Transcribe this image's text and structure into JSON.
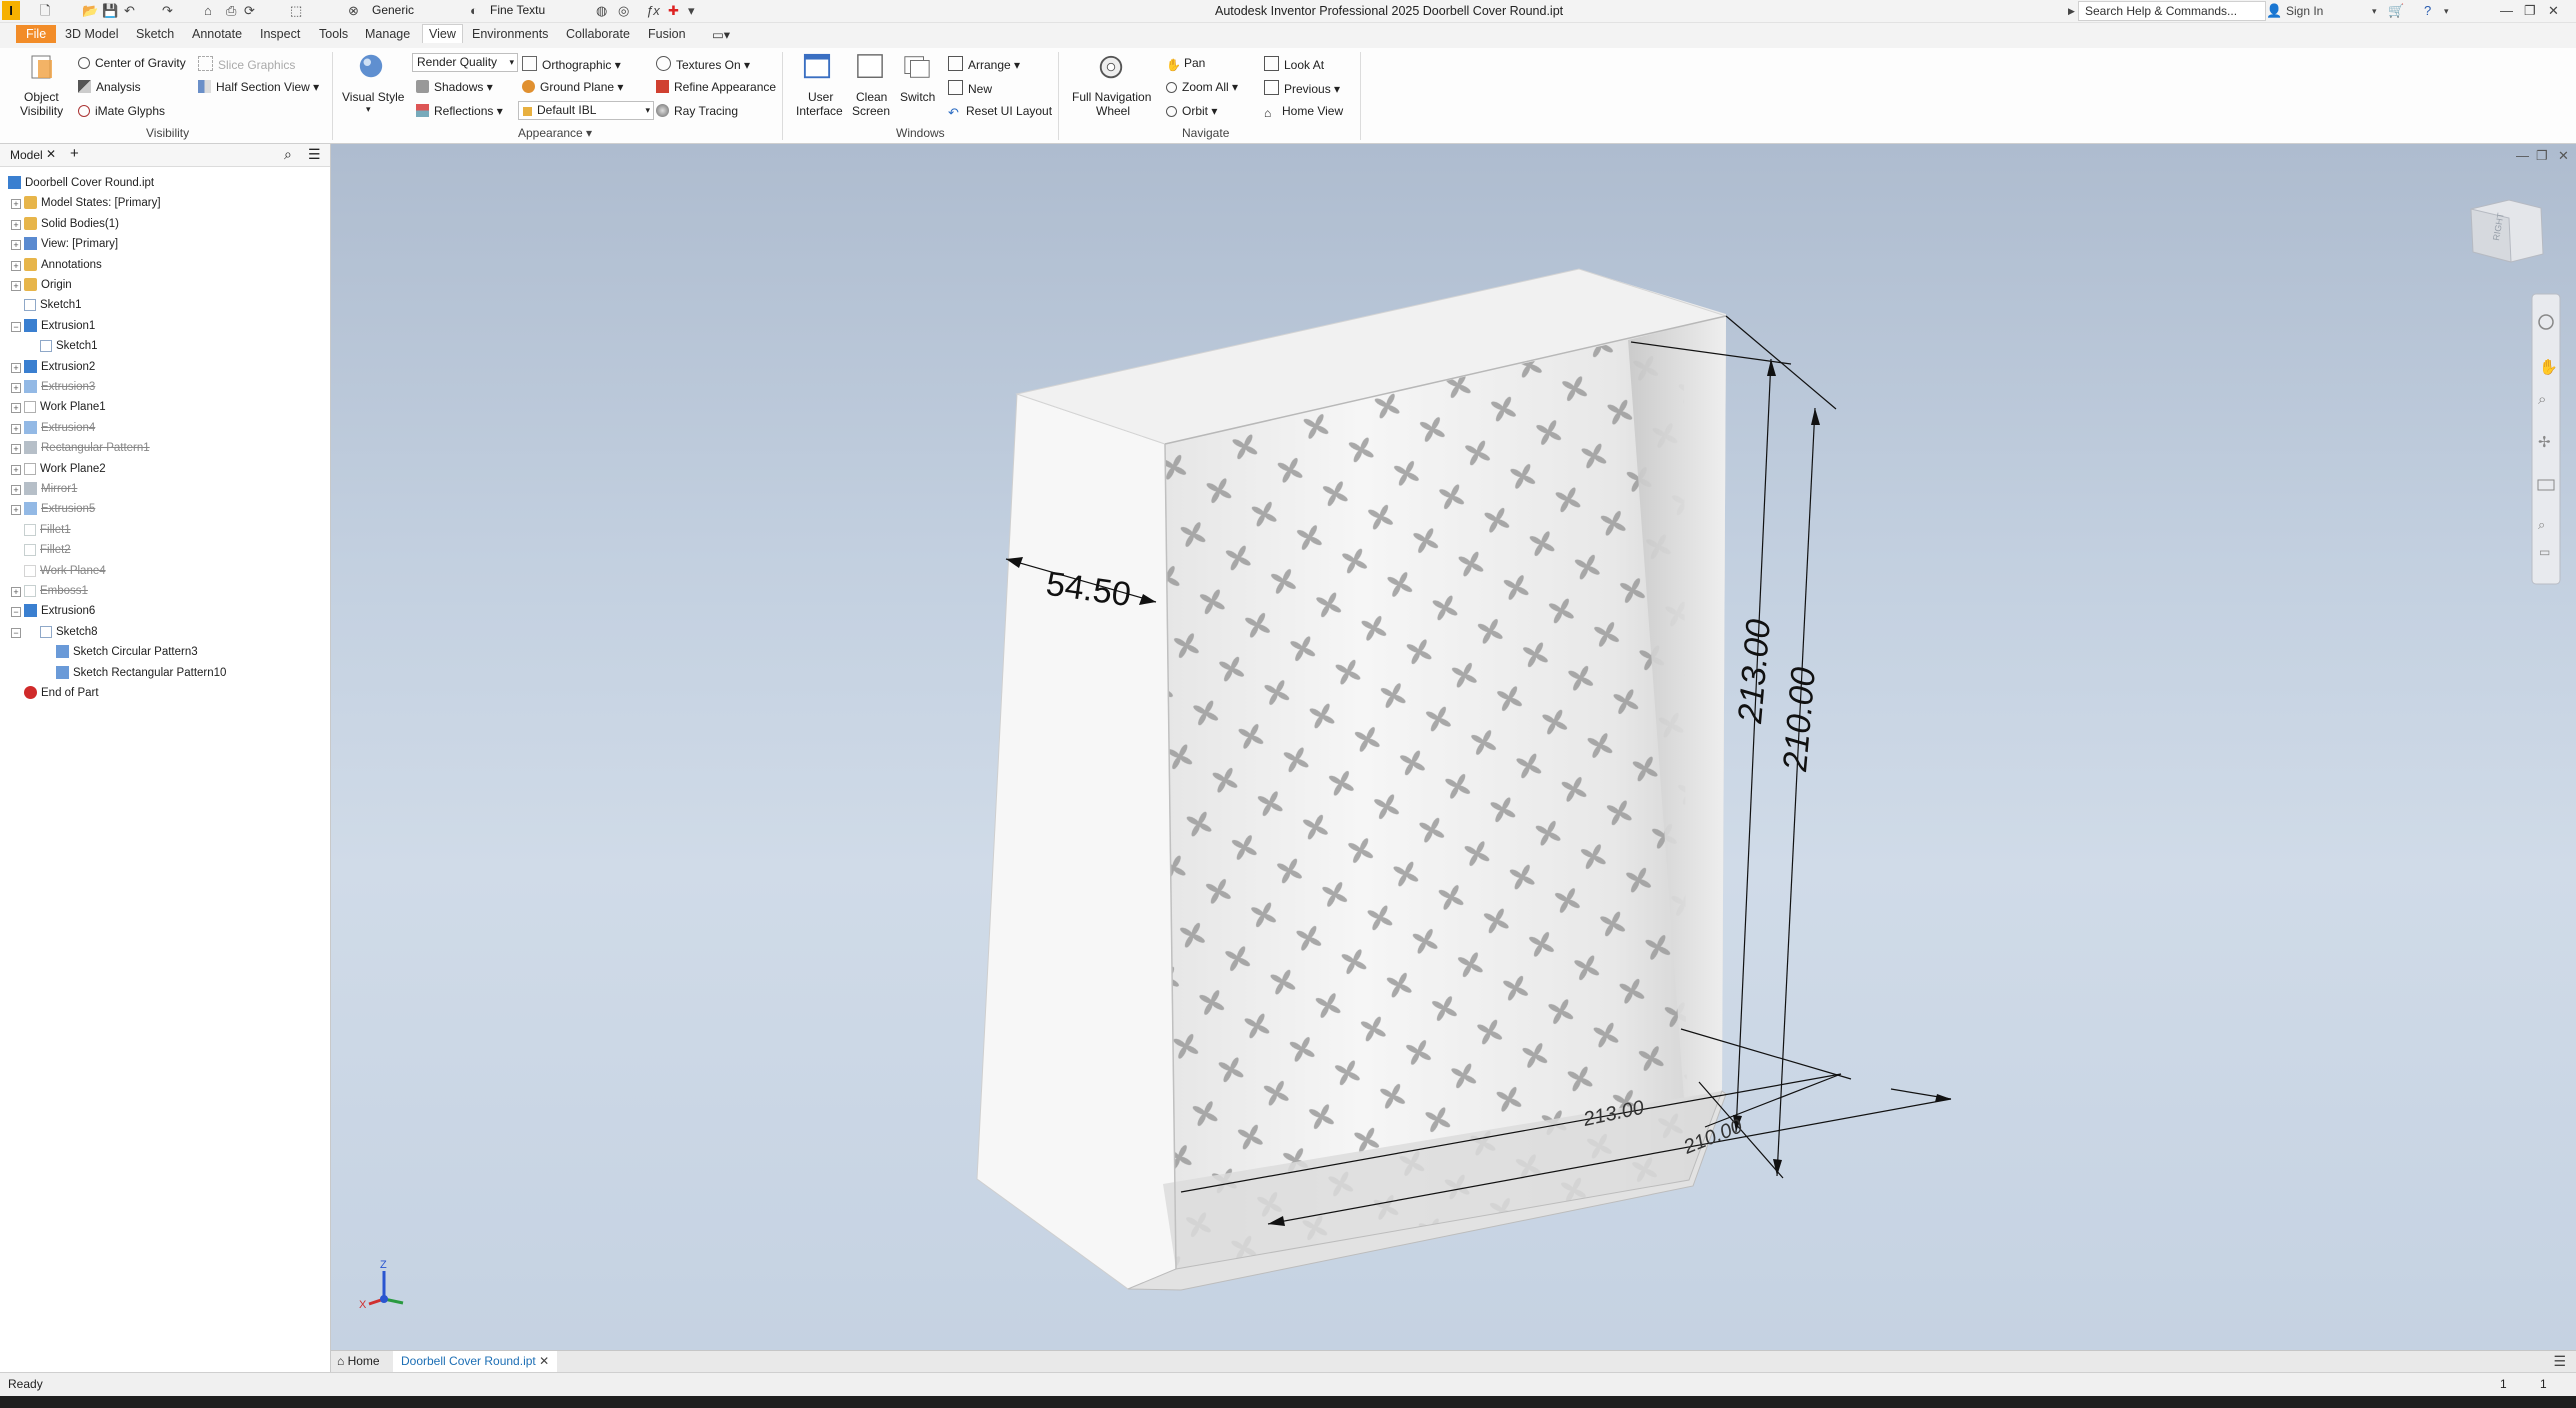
{
  "window": {
    "title": "Autodesk Inventor Professional 2025   Doorbell Cover Round.ipt",
    "search_placeholder": "Search Help & Commands...",
    "sign_in": "Sign In",
    "qat_material": "Generic",
    "qat_appearance": "Fine Textu"
  },
  "tabs": [
    "File",
    "3D Model",
    "Sketch",
    "Annotate",
    "Inspect",
    "Tools",
    "Manage",
    "View",
    "Environments",
    "Collaborate",
    "Fusion"
  ],
  "active_tab": "View",
  "ribbon": {
    "visibility": {
      "object_visibility": [
        "Object",
        "Visibility"
      ],
      "center_of_gravity": "Center of Gravity",
      "analysis": "Analysis",
      "imate_glyphs": "iMate Glyphs",
      "slice_graphics": "Slice Graphics",
      "half_section_view": "Half Section View",
      "panel_title": "Visibility"
    },
    "appearance": {
      "visual_style": "Visual Style",
      "render_quality": "Render Quality",
      "shadows": "Shadows",
      "reflections": "Reflections",
      "orthographic": "Orthographic",
      "ground_plane": "Ground Plane",
      "ibl": "Default IBL",
      "textures_on": "Textures On",
      "refine_appearance": "Refine Appearance",
      "ray_tracing": "Ray Tracing",
      "panel_title": "Appearance"
    },
    "windows": {
      "user_interface": [
        "User",
        "Interface"
      ],
      "clean_screen": [
        "Clean",
        "Screen"
      ],
      "switch": "Switch",
      "arrange": "Arrange",
      "new": "New",
      "reset_ui_layout": "Reset UI Layout",
      "panel_title": "Windows"
    },
    "navigate": {
      "full_navigation_wheel": [
        "Full Navigation",
        "Wheel"
      ],
      "pan": "Pan",
      "zoom_all": "Zoom All",
      "orbit": "Orbit",
      "look_at": "Look At",
      "previous": "Previous",
      "home_view": "Home View",
      "panel_title": "Navigate"
    }
  },
  "browser": {
    "tab_label": "Model",
    "items": [
      {
        "label": "Doorbell Cover Round.ipt",
        "icon": "part-icon",
        "suppressed": false
      },
      {
        "label": "Model States: [Primary]",
        "icon": "folder-icon",
        "suppressed": false
      },
      {
        "label": "Solid Bodies(1)",
        "icon": "folder-icon",
        "suppressed": false
      },
      {
        "label": "View: [Primary]",
        "icon": "view-icon",
        "suppressed": false
      },
      {
        "label": "Annotations",
        "icon": "folder-icon",
        "suppressed": false
      },
      {
        "label": "Origin",
        "icon": "folder-icon",
        "suppressed": false
      },
      {
        "label": "Sketch1",
        "icon": "sketch-icon",
        "suppressed": false
      },
      {
        "label": "Extrusion1",
        "icon": "extrusion-icon",
        "suppressed": false
      },
      {
        "label": "Sketch1",
        "icon": "sketch-icon",
        "suppressed": false
      },
      {
        "label": "Extrusion2",
        "icon": "extrusion-icon",
        "suppressed": false
      },
      {
        "label": "Extrusion3",
        "icon": "extrusion-icon",
        "suppressed": true
      },
      {
        "label": "Work Plane1",
        "icon": "workplane-icon",
        "suppressed": false
      },
      {
        "label": "Extrusion4",
        "icon": "extrusion-icon",
        "suppressed": true
      },
      {
        "label": "Rectangular Pattern1",
        "icon": "pattern-icon",
        "suppressed": true
      },
      {
        "label": "Work Plane2",
        "icon": "workplane-icon",
        "suppressed": false
      },
      {
        "label": "Mirror1",
        "icon": "mirror-icon",
        "suppressed": true
      },
      {
        "label": "Extrusion5",
        "icon": "extrusion-icon",
        "suppressed": true
      },
      {
        "label": "Fillet1",
        "icon": "fillet-icon",
        "suppressed": true
      },
      {
        "label": "Fillet2",
        "icon": "fillet-icon",
        "suppressed": true
      },
      {
        "label": "Work Plane4",
        "icon": "workplane-icon",
        "suppressed": true
      },
      {
        "label": "Emboss1",
        "icon": "emboss-icon",
        "suppressed": true
      },
      {
        "label": "Extrusion6",
        "icon": "extrusion-icon",
        "suppressed": false
      },
      {
        "label": "Sketch8",
        "icon": "sketch-icon",
        "suppressed": false
      },
      {
        "label": "Sketch Circular Pattern3",
        "icon": "circular-pattern-icon",
        "suppressed": false
      },
      {
        "label": "Sketch Rectangular Pattern10",
        "icon": "rect-pattern-icon",
        "suppressed": false
      },
      {
        "label": "End of Part",
        "icon": "end-of-part-icon",
        "suppressed": false
      }
    ]
  },
  "viewport": {
    "dimensions": [
      "54.50",
      "213.00",
      "210.00",
      "213.00",
      "210.00"
    ],
    "viewcube_label": "RIGHT"
  },
  "doc_tabs": {
    "home": "Home",
    "active": "Doorbell Cover Round.ipt"
  },
  "status": {
    "text": "Ready",
    "right1": "1",
    "right2": "1"
  }
}
